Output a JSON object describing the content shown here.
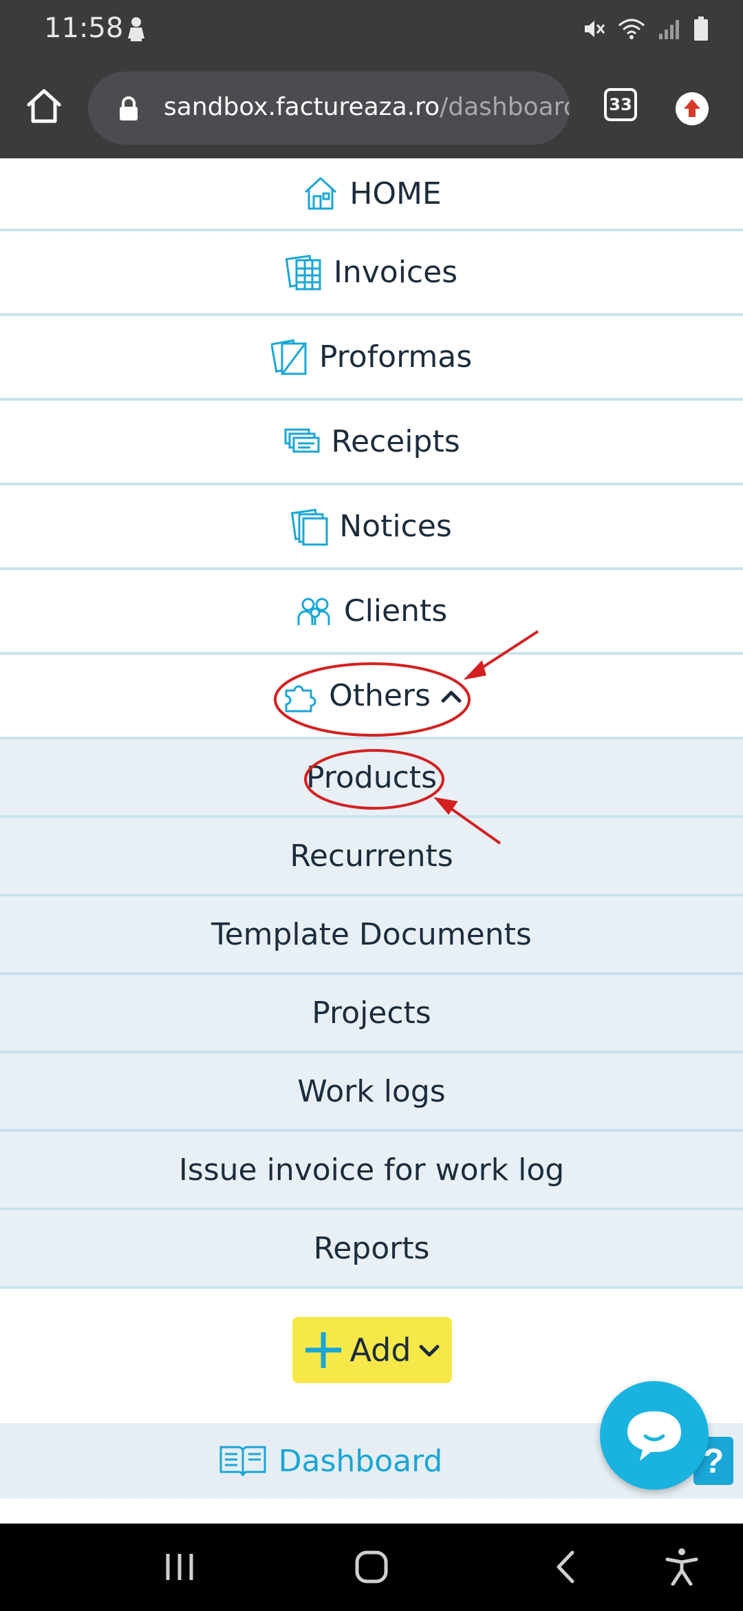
{
  "status_bar": {
    "time": "11:58"
  },
  "browser": {
    "url_host": "sandbox.factureaza.ro",
    "url_path": "/dashboard",
    "tab_count": "33"
  },
  "menu": {
    "items": [
      {
        "label": "HOME",
        "icon": "house-icon"
      },
      {
        "label": "Invoices",
        "icon": "invoices-icon"
      },
      {
        "label": "Proformas",
        "icon": "proformas-icon"
      },
      {
        "label": "Receipts",
        "icon": "receipts-icon"
      },
      {
        "label": "Notices",
        "icon": "notices-icon"
      },
      {
        "label": "Clients",
        "icon": "clients-icon"
      },
      {
        "label": "Others",
        "icon": "puzzle-icon",
        "expanded": true
      }
    ],
    "others_submenu": [
      "Products",
      "Recurrents",
      "Template Documents",
      "Projects",
      "Work logs",
      "Issue invoice for work log",
      "Reports"
    ]
  },
  "add_button": {
    "label": "Add"
  },
  "dashboard": {
    "label": "Dashboard"
  },
  "help": {
    "label": "?"
  },
  "colors": {
    "accent": "#1aa6d6",
    "add_button": "#f7e84a",
    "annotation": "#d42020",
    "submenu_bg": "#e8f0f5"
  }
}
